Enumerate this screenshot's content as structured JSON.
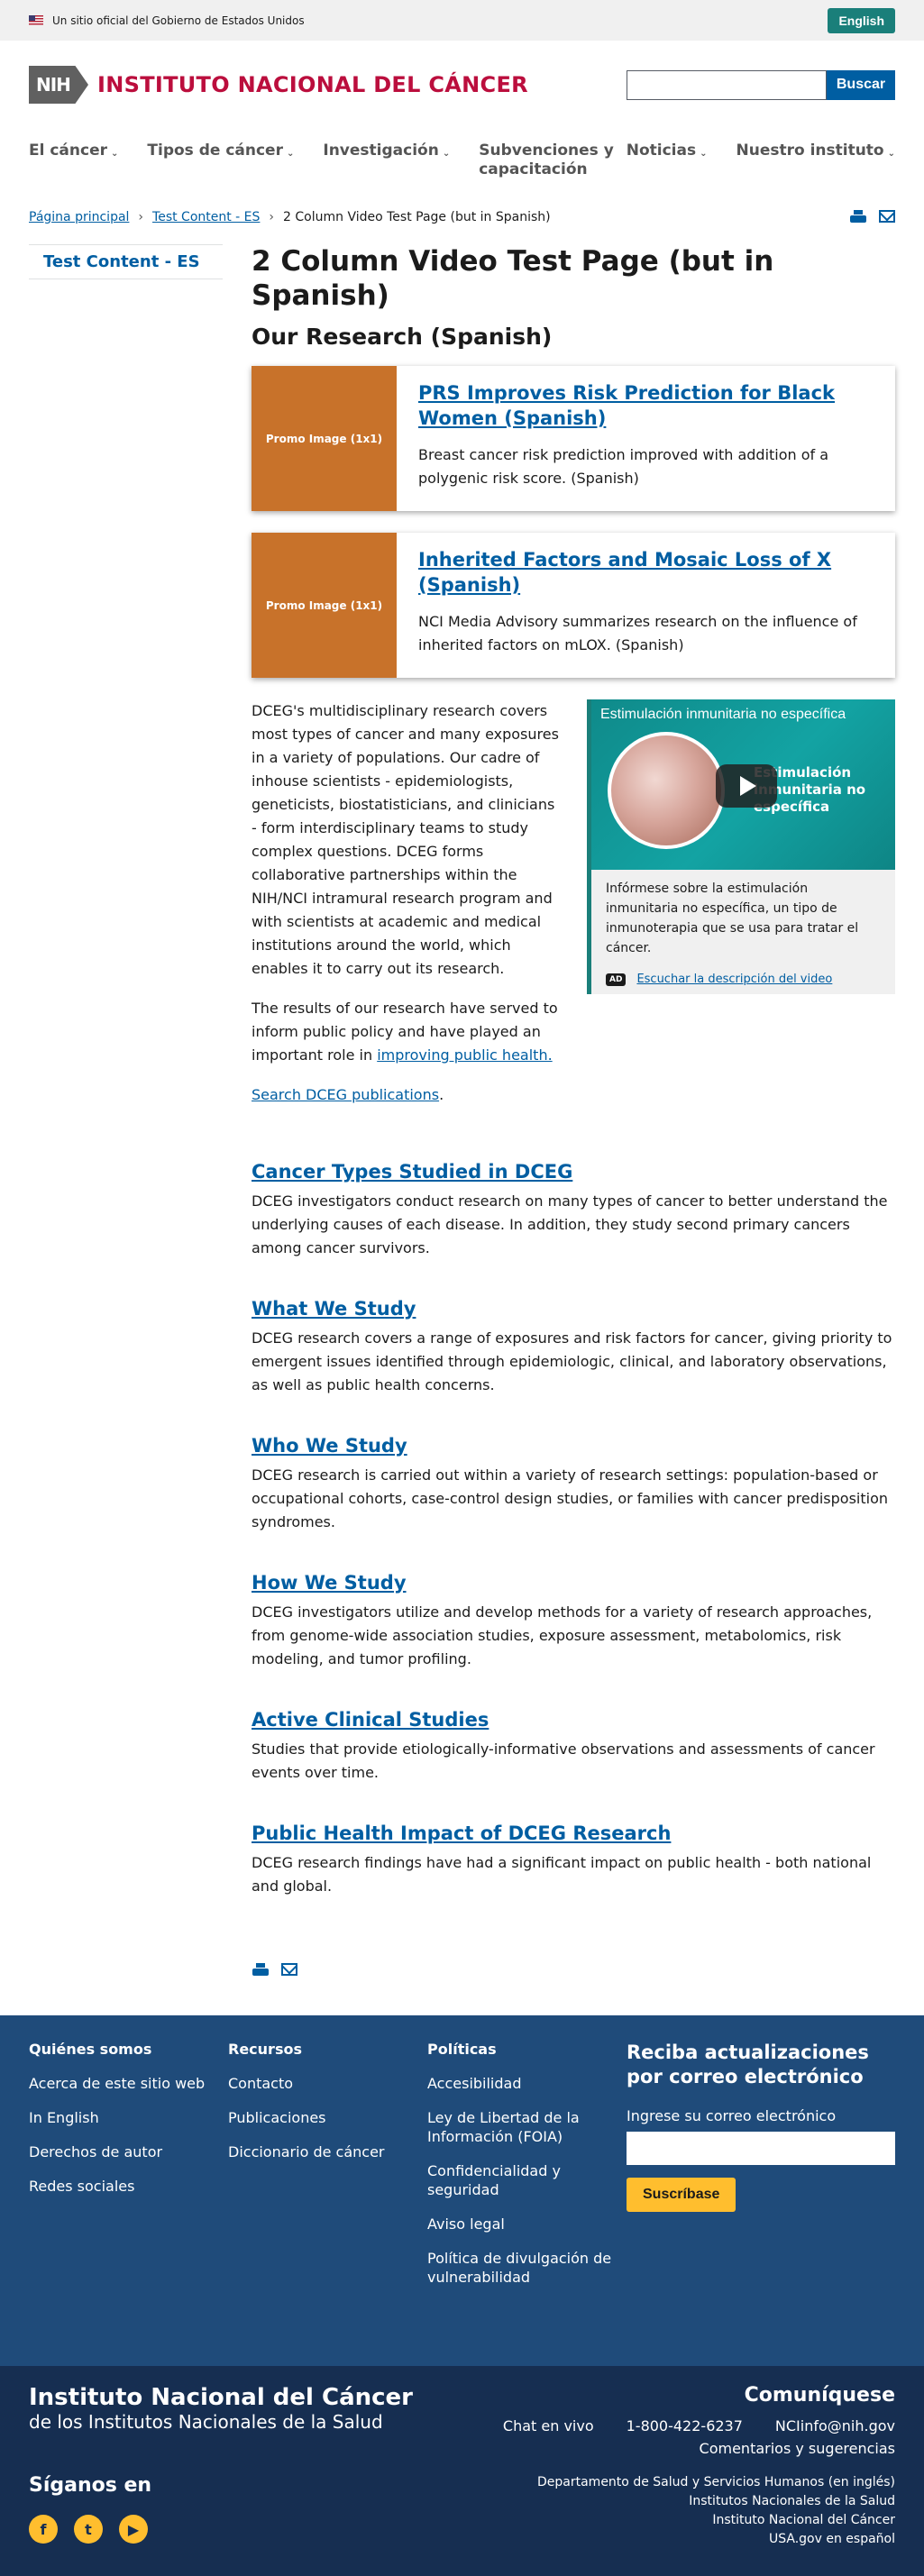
{
  "gov_banner": {
    "text": "Un sitio oficial del Gobierno de Estados Unidos",
    "lang_button": "English"
  },
  "header": {
    "logo_badge": "NIH",
    "logo_text": "INSTITUTO NACIONAL DEL CÁNCER",
    "search_button": "Buscar",
    "search_value": ""
  },
  "nav": {
    "items_left": [
      {
        "label": "El cáncer"
      },
      {
        "label": "Tipos de cáncer"
      },
      {
        "label": "Investigación"
      },
      {
        "label": "Subvenciones y capacitación"
      }
    ],
    "items_right": [
      {
        "label": "Noticias"
      },
      {
        "label": "Nuestro instituto"
      }
    ]
  },
  "breadcrumb": {
    "home": "Página principal",
    "parent": "Test Content - ES",
    "current": "2 Column Video Test Page (but in Spanish)"
  },
  "sidebar": {
    "link": "Test Content - ES"
  },
  "main": {
    "title": "2 Column Video Test Page (but in Spanish)",
    "section_title": "Our Research (Spanish)",
    "cards": [
      {
        "image_label": "Promo Image (1x1)",
        "title": "PRS Improves Risk Prediction for Black Women (Spanish)",
        "desc": "Breast cancer risk prediction improved with addition of a polygenic risk score. (Spanish)"
      },
      {
        "image_label": "Promo Image (1x1)",
        "title": "Inherited Factors and Mosaic Loss of X (Spanish)",
        "desc": "NCI Media Advisory summarizes research on the influence of inherited factors on mLOX. (Spanish)"
      }
    ],
    "body_p1": "DCEG's multidisciplinary research covers most types of cancer and many exposures in a variety of populations. Our cadre of inhouse scientists - epidemiologists, geneticists, biostatisticians, and clinicians - form interdisciplinary teams to study complex questions. DCEG forms collaborative partnerships within the NIH/NCI intramural research program and with scientists at academic and medical institutions around the world, which enables it to carry out its research.",
    "body_p2_prefix": "The results of our research have served to inform public policy and have played an important role in ",
    "body_p2_link": "improving public health.",
    "search_link": "Search DCEG publications",
    "video": {
      "title": "Estimulación inmunitaria no específica",
      "inner_text": "Estimulación inmunitaria no específica",
      "caption": "Infórmese sobre la estimulación inmunitaria no específica, un tipo de inmunoterapia que se usa para tratar el cáncer.",
      "ad_badge": "AD",
      "ad_link": "Escuchar la descripción del video"
    },
    "topics": [
      {
        "title": "Cancer Types Studied in DCEG",
        "text": "DCEG investigators conduct research on many types of cancer to better understand the underlying causes of each disease. In addition, they study second primary cancers among cancer survivors."
      },
      {
        "title": "What We Study",
        "text": "DCEG research covers a range of exposures and risk factors for cancer, giving priority to emergent issues identified through epidemiologic, clinical, and laboratory observations, as well as public health concerns."
      },
      {
        "title": "Who We Study",
        "text": "DCEG research is carried out within a variety of research settings: population-based or occupational cohorts, case-control design studies, or families with cancer predisposition syndromes."
      },
      {
        "title": "How We Study",
        "text": "DCEG investigators utilize and develop methods for a variety of research approaches, from genome-wide association studies, exposure assessment, metabolomics, risk modeling, and tumor profiling."
      },
      {
        "title": "Active Clinical Studies",
        "text": "Studies that provide etiologically-informative observations and assessments of cancer events over time."
      },
      {
        "title": "Public Health Impact of DCEG Research",
        "text": "DCEG research findings have had a significant impact on public health - both national and global."
      }
    ]
  },
  "footer": {
    "col1": {
      "title": "Quiénes somos",
      "links": [
        "Acerca de este sitio web",
        "In English",
        "Derechos de autor",
        "Redes sociales"
      ]
    },
    "col2": {
      "title": "Recursos",
      "links": [
        "Contacto",
        "Publicaciones",
        "Diccionario de cáncer"
      ]
    },
    "col3": {
      "title": "Políticas",
      "links": [
        "Accesibilidad",
        "Ley de Libertad de la Información (FOIA)",
        "Confidencialidad y seguridad",
        "Aviso legal",
        "Política de divulgación de vulnerabilidad"
      ]
    },
    "signup": {
      "title": "Reciba actualizaciones por correo electrónico",
      "label": "Ingrese su correo electrónico",
      "button": "Suscríbase"
    }
  },
  "footer2": {
    "org_name": "Instituto Nacional del Cáncer",
    "org_sub": "de los Institutos Nacionales de la Salud",
    "follow": "Síganos en",
    "contact_title": "Comuníquese",
    "chat": "Chat en vivo",
    "phone": "1-800-422-6237",
    "email": "NCIinfo@nih.gov",
    "comments": "Comentarios y sugerencias",
    "links": [
      "Departamento de Salud y Servicios Humanos (en inglés)",
      "Institutos Nacionales de la Salud",
      "Instituto Nacional del Cáncer",
      "USA.gov en español"
    ]
  }
}
